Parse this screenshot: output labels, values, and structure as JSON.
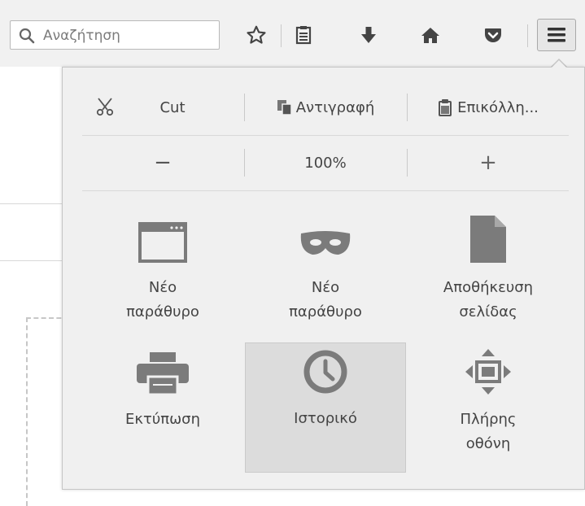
{
  "search": {
    "placeholder": "Αναζήτηση"
  },
  "toolbar": {
    "icons": [
      "star-icon",
      "reading-list-icon",
      "download-icon",
      "home-icon",
      "pocket-icon",
      "menu-icon"
    ]
  },
  "menu": {
    "edit": {
      "cut": "Cut",
      "copy": "Αντιγραφή",
      "paste": "Επικόλλη..."
    },
    "zoom": {
      "minus": "−",
      "level": "100%",
      "plus": "+"
    },
    "tiles": [
      {
        "label": "Νέο\nπαράθυρο",
        "icon": "window-icon"
      },
      {
        "label": "Νέο\nπαράθυρο",
        "icon": "private-mask-icon"
      },
      {
        "label": "Αποθήκευση\nσελίδας",
        "icon": "page-icon"
      },
      {
        "label": "Εκτύπωση",
        "icon": "printer-icon"
      },
      {
        "label": "Ιστορικό",
        "icon": "clock-icon"
      },
      {
        "label": "Πλήρης\nοθόνη",
        "icon": "fullscreen-icon"
      }
    ]
  },
  "colors": {
    "icon": "#555555",
    "tile_icon": "#7b7b7b",
    "panel_bg": "#f0f0f0",
    "active_tile": "#dcdcdc"
  }
}
